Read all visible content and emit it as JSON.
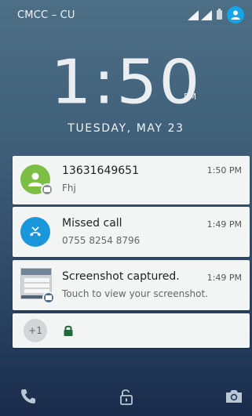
{
  "status": {
    "carrier": "CMCC – CU"
  },
  "lockscreen": {
    "time": "1:50",
    "ampm": "PM",
    "date": "TUESDAY, MAY 23"
  },
  "notifications": [
    {
      "title": "13631649651",
      "subtitle": "Fhj",
      "time": "1:50 PM",
      "icon": "person-icon",
      "badge_icon": "message-icon"
    },
    {
      "title": "Missed call",
      "subtitle": "0755 8254 8796",
      "time": "1:49 PM",
      "icon": "missed-call-icon"
    },
    {
      "title": "Screenshot captured.",
      "subtitle": "Touch to view your screenshot.",
      "time": "1:49 PM",
      "icon": "screenshot-thumbnail",
      "badge_icon": "image-icon"
    }
  ],
  "more": {
    "count_label": "+1",
    "icon": "lock-icon"
  },
  "bottom_bar": {
    "left_icon": "phone-icon",
    "center_icon": "unlock-icon",
    "right_icon": "camera-icon"
  },
  "colors": {
    "accent_blue": "#1996dc",
    "contact_green": "#7cbf44",
    "lock_green": "#1f6b3a"
  }
}
